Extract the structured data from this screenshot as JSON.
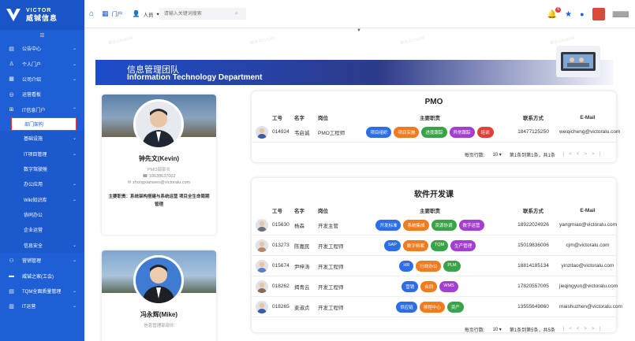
{
  "brand": {
    "en": "VICTOR",
    "cn": "威铖信息"
  },
  "sidebar": {
    "items": [
      {
        "icon": "home-icon",
        "label": "公告中心",
        "chev": true
      },
      {
        "icon": "user-icon",
        "label": "个人门户",
        "chev": true
      },
      {
        "icon": "building-icon",
        "label": "公司介绍",
        "chev": true
      },
      {
        "icon": "dashboard-icon",
        "label": "运营看板",
        "chev": false
      },
      {
        "icon": "grid-icon",
        "label": "IT信息门户",
        "chev": true
      },
      {
        "label": "部门架构",
        "active": true
      },
      {
        "label": "基础设施",
        "chev": true
      },
      {
        "label": "IT项目管理",
        "chev": true
      },
      {
        "label": "数字驾驶舱",
        "chev": false
      },
      {
        "label": "办公应用",
        "chev": true
      },
      {
        "label": "Wiki知识库",
        "chev": true
      },
      {
        "label": "协同办公",
        "chev": false
      },
      {
        "label": "企业运营",
        "chev": false
      },
      {
        "label": "信息安全",
        "chev": true
      },
      {
        "icon": "group-icon",
        "label": "营销管理",
        "chev": true
      },
      {
        "icon": "home2-icon",
        "label": "威铖之家(工会)",
        "chev": false
      },
      {
        "icon": "chart-icon",
        "label": "TQM全面质量管理",
        "chev": true
      },
      {
        "icon": "book-icon",
        "label": "IT运营",
        "chev": true
      }
    ]
  },
  "topbar": {
    "portal_label": "门户",
    "filter_label": "人员",
    "search_placeholder": "请输入关键词搜索",
    "notifications": "6"
  },
  "banner": {
    "title_cn": "信息管理团队",
    "title_en": "Information Technology Department"
  },
  "watermark": "黄淑贞018265",
  "leaders": [
    {
      "name": "钟先文(Kevin)",
      "role": "PMO部部长",
      "phone": "18638637002",
      "email": "zhongxianwen@victoralu.com",
      "duty": "主要职责：系统架构搭建与系统运营 项目全生命周期管理"
    },
    {
      "name": "冯永辉(Mike)",
      "role": "信息管理部部长"
    }
  ],
  "table_headers": {
    "id": "工号",
    "name": "名字",
    "post": "岗位",
    "duty": "主要职责",
    "phone": "联系方式",
    "email": "E-Mail"
  },
  "depts": [
    {
      "title": "PMO",
      "rows": [
        {
          "id": "014924",
          "name": "韦启诚",
          "post": "PMO工程师",
          "tags": [
            {
              "t": "项目组织",
              "c": "#2d6ee6"
            },
            {
              "t": "项目实施",
              "c": "#f07c1f"
            },
            {
              "t": "进度跟踪",
              "c": "#3aa248"
            },
            {
              "t": "异常跟踪",
              "c": "#a23fcf"
            },
            {
              "t": "培训",
              "c": "#e0403a"
            }
          ],
          "phone": "18477125250",
          "email": "weiqicheng@victoralu.com"
        }
      ],
      "pager": {
        "per_page_label": "每页行数:",
        "per_page": "10",
        "summary": "第1条到第1条，共1条"
      }
    },
    {
      "title": "软件开发课",
      "rows": [
        {
          "id": "015630",
          "name": "杨森",
          "post": "开发主管",
          "tags": [
            {
              "t": "开发标准",
              "c": "#2d6ee6"
            },
            {
              "t": "系统集成",
              "c": "#f07c1f"
            },
            {
              "t": "资源协调",
              "c": "#3aa248"
            },
            {
              "t": "数字运营",
              "c": "#a23fcf"
            }
          ],
          "phone": "18922024926",
          "email": "yangmiao@victoralu.com"
        },
        {
          "id": "013273",
          "name": "陈嘉民",
          "post": "开发工程师",
          "tags": [
            {
              "t": "SAP",
              "c": "#2d6ee6"
            },
            {
              "t": "数字档案",
              "c": "#f07c1f"
            },
            {
              "t": "TQM",
              "c": "#3aa248"
            },
            {
              "t": "生产管理",
              "c": "#a23fcf"
            }
          ],
          "phone": "15019836006",
          "email": "cjm@victoralu.com"
        },
        {
          "id": "015674",
          "name": "尹梓涛",
          "post": "开发工程师",
          "tags": [
            {
              "t": "HR",
              "c": "#2d6ee6"
            },
            {
              "t": "行政办公",
              "c": "#f07c1f"
            },
            {
              "t": "PLM",
              "c": "#3aa248"
            }
          ],
          "phone": "18814185134",
          "email": "yinzitao@victoralu.com"
        },
        {
          "id": "018262",
          "name": "揭青云",
          "post": "开发工程师",
          "tags": [
            {
              "t": "营销",
              "c": "#2d6ee6"
            },
            {
              "t": "合同",
              "c": "#f07c1f"
            },
            {
              "t": "WMS",
              "c": "#a23fcf"
            }
          ],
          "phone": "17820557005",
          "email": "jieqingyun@victoralu.com"
        },
        {
          "id": "018265",
          "name": "麦淑贞",
          "post": "开发工程师",
          "tags": [
            {
              "t": "供应链",
              "c": "#2d6ee6"
            },
            {
              "t": "排程中心",
              "c": "#f07c1f"
            },
            {
              "t": "资产",
              "c": "#3aa248"
            }
          ],
          "phone": "13555649860",
          "email": "maishuzhen@victoralu.com"
        }
      ],
      "pager": {
        "per_page_label": "每页行数:",
        "per_page": "10",
        "summary": "第1条到第5条，共5条"
      }
    }
  ]
}
